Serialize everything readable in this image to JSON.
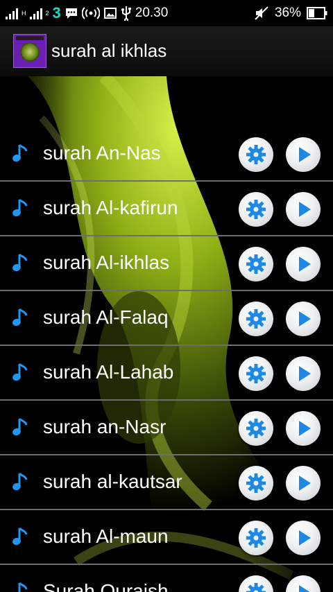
{
  "status_bar": {
    "tiny_labels": [
      "H",
      "2"
    ],
    "network_label": "3",
    "time": "20.30",
    "battery": "36%",
    "icons": [
      "signal-icon",
      "signal-icon",
      "network-3-icon",
      "chat-icon",
      "hotspot-icon",
      "image-icon",
      "usb-icon",
      "mute-icon",
      "battery-icon"
    ]
  },
  "app_bar": {
    "title": "surah al ikhlas",
    "icon": "quran-app-icon"
  },
  "list": {
    "items": [
      {
        "label": "surah An-Nas"
      },
      {
        "label": "surah Al-kafirun"
      },
      {
        "label": "surah Al-ikhlas"
      },
      {
        "label": "surah Al-Falaq"
      },
      {
        "label": "surah Al-Lahab"
      },
      {
        "label": "surah an-Nasr"
      },
      {
        "label": "surah al-kautsar"
      },
      {
        "label": "surah Al-maun"
      },
      {
        "label": "Surah Quraish"
      }
    ],
    "row_icons": [
      "music-note-icon",
      "gear-icon",
      "play-icon"
    ]
  },
  "colors": {
    "accent_blue": "#1e88e5",
    "background_green": "#9fc51a",
    "divider": "#6e6e6e"
  }
}
